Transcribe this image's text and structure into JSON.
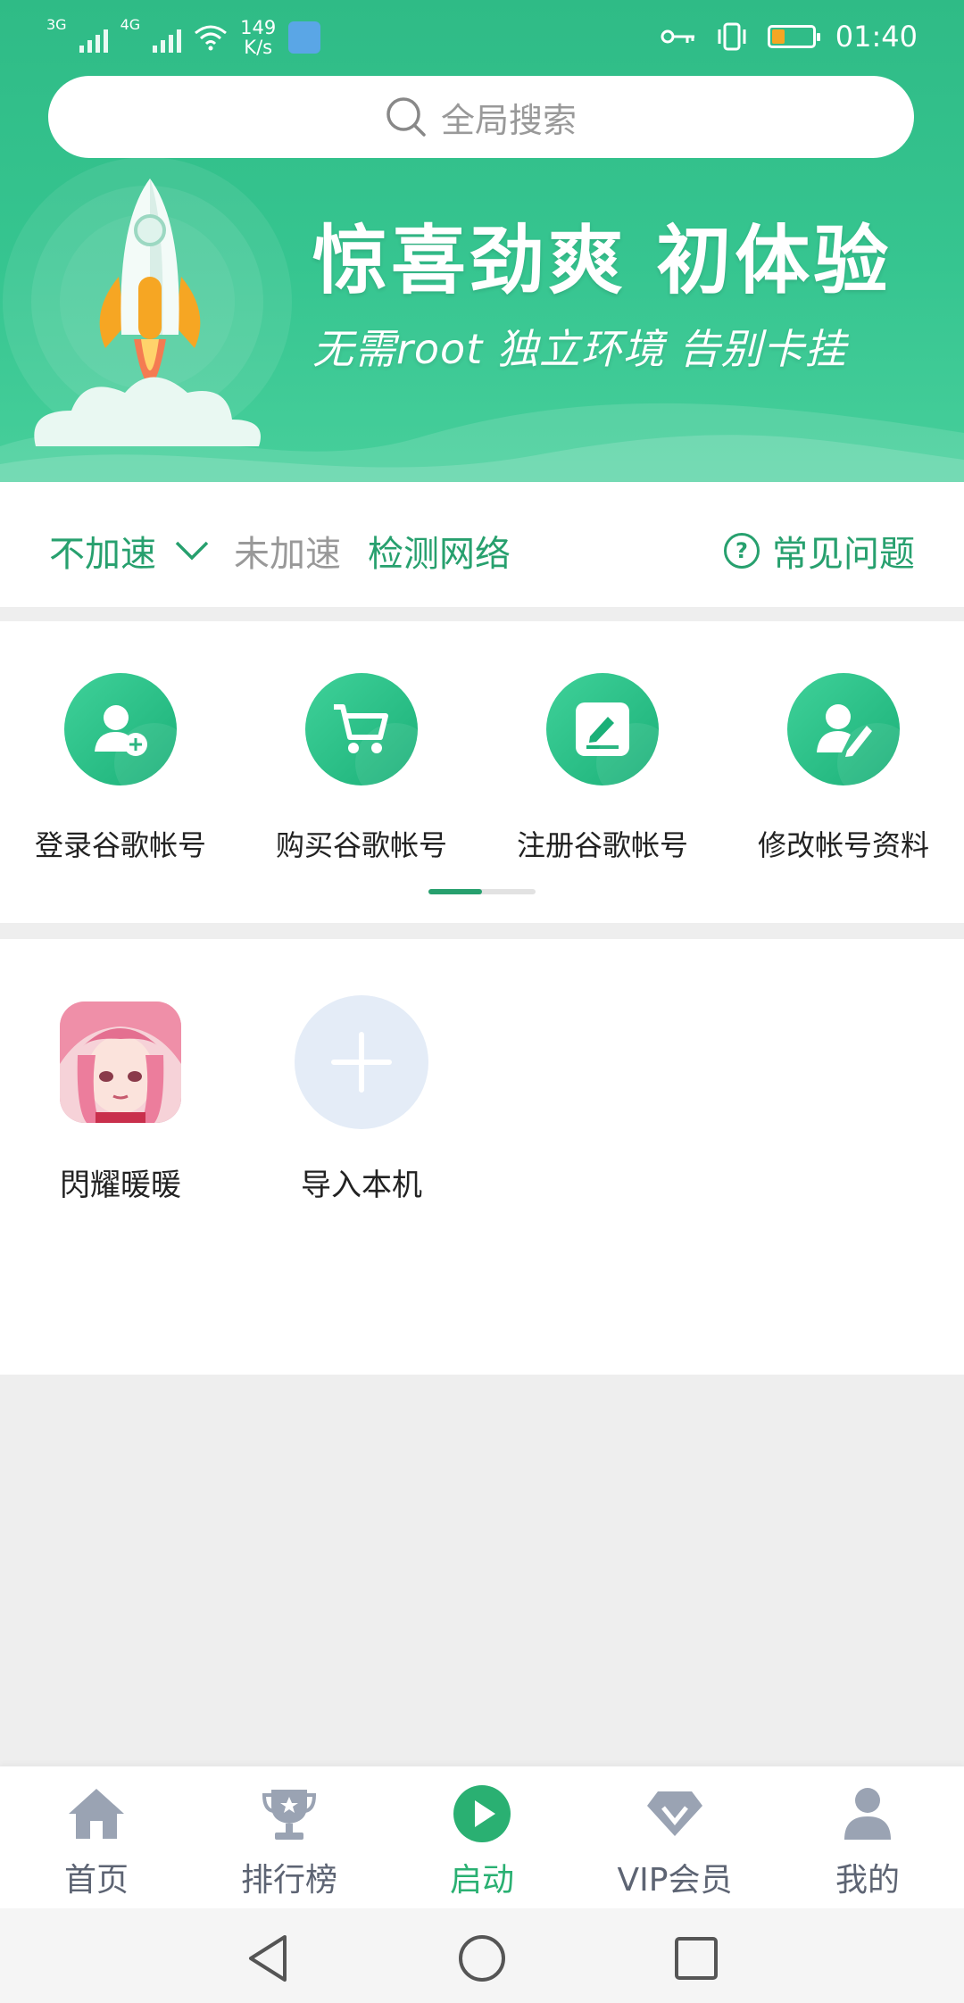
{
  "status_bar": {
    "net1": "3G",
    "net2": "4G",
    "speed_value": "149",
    "speed_unit": "K/s",
    "time": "01:40"
  },
  "search": {
    "placeholder": "全局搜索",
    "icon": "search-icon"
  },
  "banner": {
    "headline": "惊喜劲爽  初体验",
    "subline": "无需root  独立环境  告别卡挂"
  },
  "accel": {
    "mode": "不加速",
    "status": "未加速",
    "detect": "检测网络",
    "faq": "常见问题",
    "faq_icon": "?"
  },
  "accounts": {
    "items": [
      {
        "label": "登录谷歌帐号",
        "icon": "user-add-icon"
      },
      {
        "label": "购买谷歌帐号",
        "icon": "cart-icon"
      },
      {
        "label": "注册谷歌帐号",
        "icon": "edit-icon"
      },
      {
        "label": "修改帐号资料",
        "icon": "user-edit-icon"
      }
    ],
    "page_indicator": {
      "active": 1,
      "total": 2
    }
  },
  "apps": {
    "items": [
      {
        "label": "閃耀暖暖"
      },
      {
        "label": "导入本机"
      }
    ]
  },
  "bottom_nav": {
    "items": [
      {
        "label": "首页",
        "icon": "home-icon"
      },
      {
        "label": "排行榜",
        "icon": "trophy-icon"
      },
      {
        "label": "启动",
        "icon": "play-icon",
        "active": true
      },
      {
        "label": "VIP会员",
        "icon": "diamond-icon"
      },
      {
        "label": "我的",
        "icon": "person-icon"
      }
    ]
  },
  "colors": {
    "brand_green": "#2fbb86",
    "accent_green": "#27a06e",
    "active_nav": "#2ab072",
    "inactive_nav": "#9aa3b3"
  }
}
